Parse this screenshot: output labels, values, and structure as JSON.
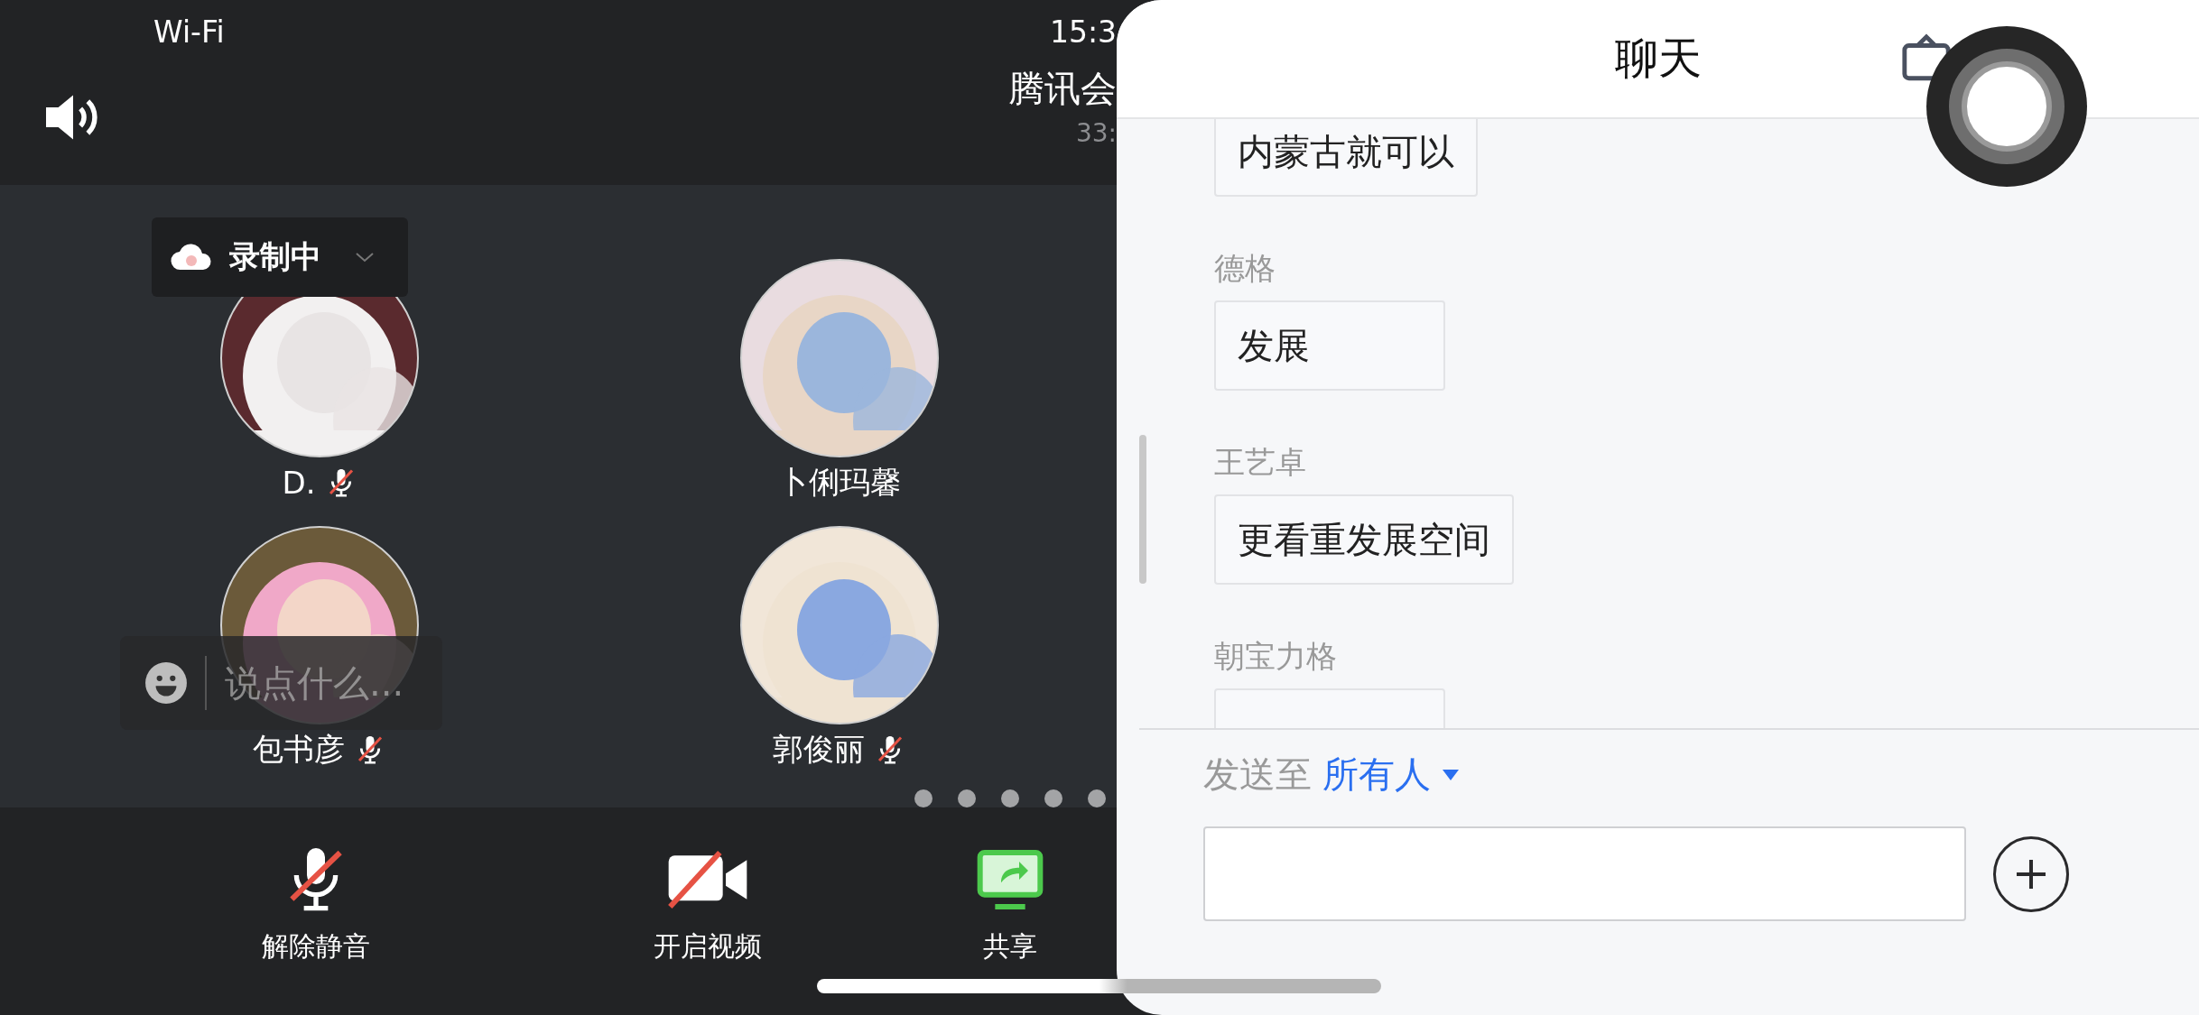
{
  "status_bar": {
    "network": "Wi-Fi",
    "time": "15:3"
  },
  "meeting": {
    "title": "腾讯会",
    "duration": "33:"
  },
  "recording": {
    "label": "录制中"
  },
  "participants": [
    {
      "name": "D.",
      "muted": true
    },
    {
      "name": "卜俐玛馨",
      "muted": false
    },
    {
      "name": "包书彦",
      "muted": true
    },
    {
      "name": "郭俊丽",
      "muted": true
    }
  ],
  "quick_chat": {
    "placeholder": "说点什么..."
  },
  "toolbar": [
    {
      "kind": "mic",
      "label": "解除静音",
      "off": true
    },
    {
      "kind": "video",
      "label": "开启视频",
      "off": true
    },
    {
      "kind": "share",
      "label": "共享"
    }
  ],
  "chat": {
    "title": "聊天",
    "messages": [
      {
        "text": "内蒙古就可以"
      },
      {
        "sender": "德格",
        "text": "发展"
      },
      {
        "sender": "王艺卓",
        "text": "更看重发展空间"
      },
      {
        "sender": "朝宝力格"
      }
    ],
    "send_to": {
      "label": "发送至",
      "target": "所有人"
    }
  }
}
